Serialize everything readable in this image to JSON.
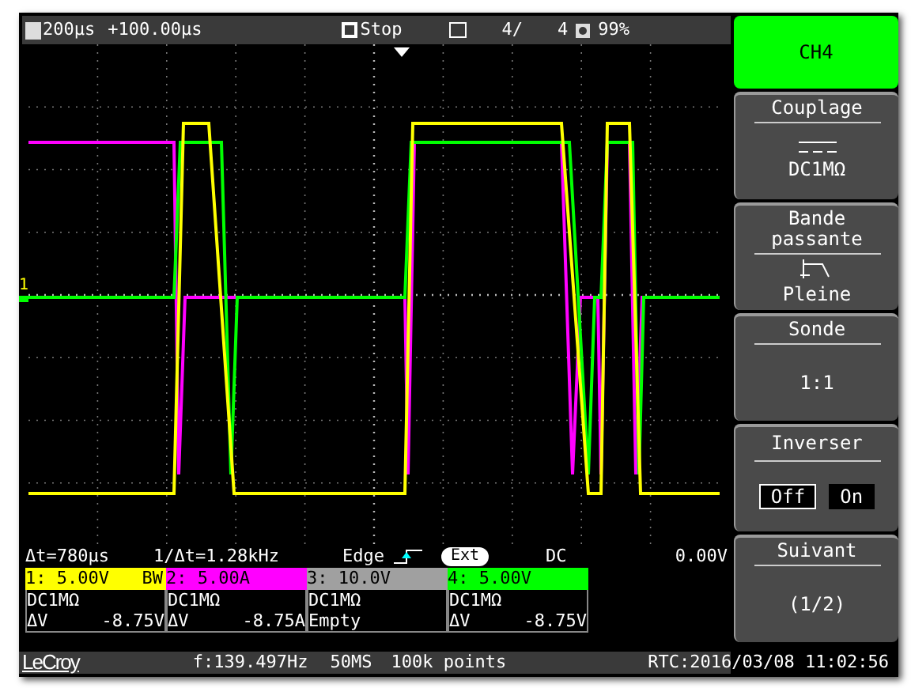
{
  "top_bar": {
    "timebase": "200µs",
    "delay": "+100.00µs",
    "run_state": "Stop",
    "acquisition_count": "4/",
    "acquisition_total": "4",
    "battery": "99%"
  },
  "markers": [
    {
      "label": "1",
      "color": "#ffff00"
    }
  ],
  "measurements": {
    "delta_t": "Δt=780µs",
    "inverse_delta_t": "1/Δt=1.28kHz",
    "trigger_type": "Edge",
    "trigger_source": "Ext",
    "trigger_coupling": "DC",
    "trigger_level": "0.00V"
  },
  "channels": [
    {
      "header": "1: 5.00V",
      "badge": "BW",
      "color": "#ffff00",
      "coupling": "DC1MΩ",
      "delta_label": "ΔV",
      "delta_value": "-8.75V"
    },
    {
      "header": "2: 5.00A",
      "color": "#ff00ff",
      "coupling": "DC1MΩ",
      "delta_label": "ΔV",
      "delta_value": "-8.75A"
    },
    {
      "header": "3: 10.0V",
      "color": "#a0a0a0",
      "coupling": "DC1MΩ",
      "delta_label": "Empty"
    },
    {
      "header": "4: 5.00V",
      "color": "#00ff00",
      "coupling": "DC1MΩ",
      "delta_label": "ΔV",
      "delta_value": "-8.75V"
    }
  ],
  "status_bar": {
    "brand": "LeCroy",
    "frequency": "f:139.497Hz",
    "sample_rate": "50MS",
    "points": "100k points",
    "rtc": "RTC:2016/03/08 11:02:56"
  },
  "menu": [
    {
      "kind": "title",
      "label": "CH4"
    },
    {
      "kind": "coupling",
      "label": "Couplage",
      "value": "DC1MΩ"
    },
    {
      "kind": "bandwidth",
      "label": "Bande passante",
      "value": "Pleine"
    },
    {
      "kind": "option",
      "label": "Sonde",
      "value": "1:1"
    },
    {
      "kind": "toggle",
      "label": "Inverser",
      "options": [
        {
          "label": "Off",
          "selected": true
        },
        {
          "label": "On",
          "selected": false
        }
      ]
    },
    {
      "kind": "option",
      "label": "Suivant",
      "value": "(1/2)"
    }
  ]
}
